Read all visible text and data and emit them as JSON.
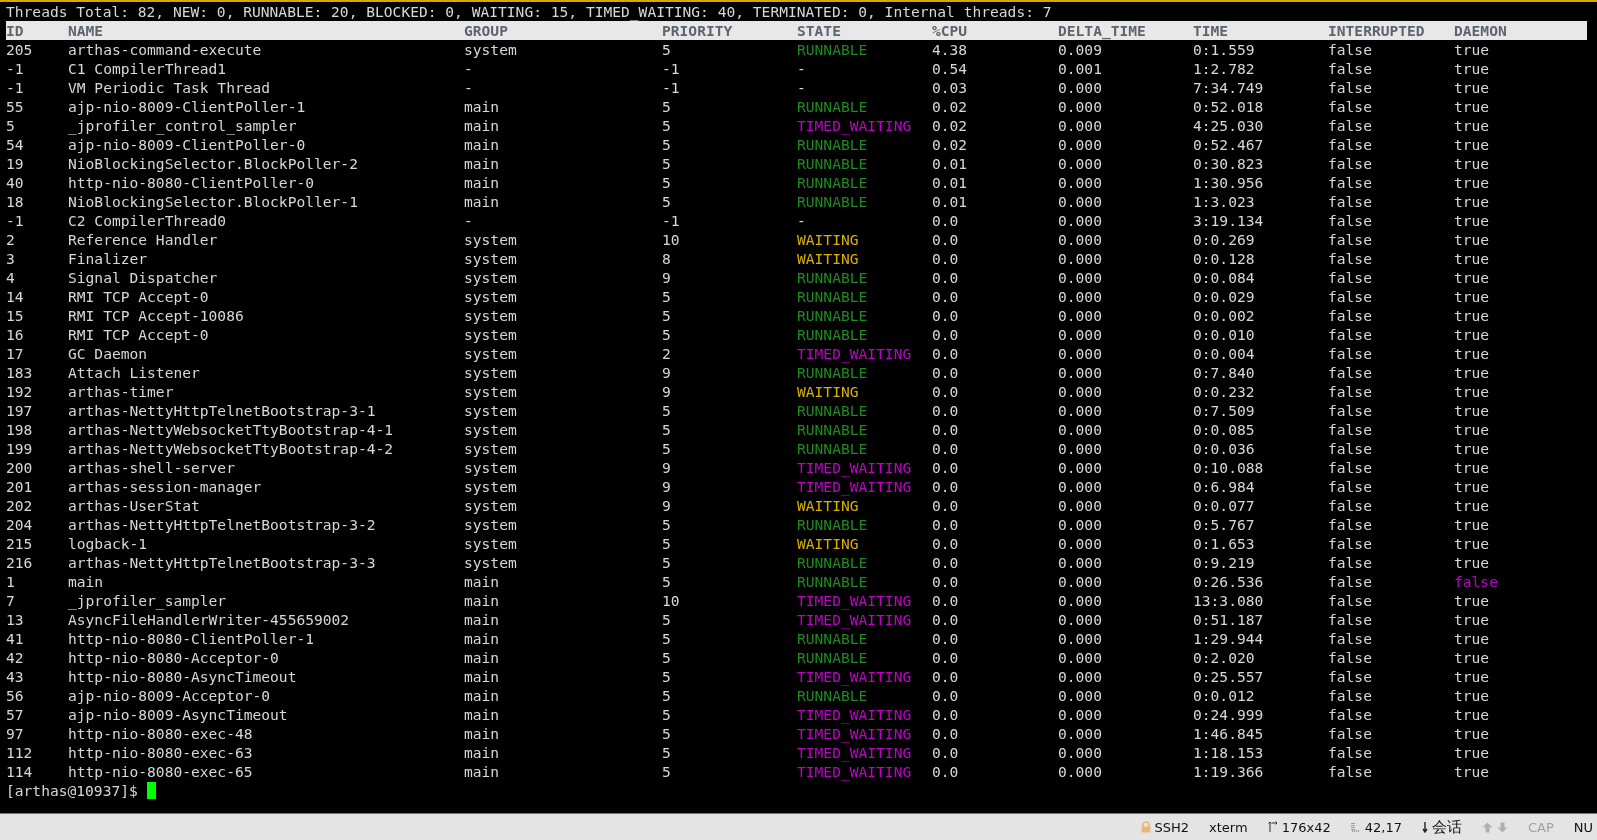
{
  "summary": "Threads Total: 82, NEW: 0, RUNNABLE: 20, BLOCKED: 0, WAITING: 15, TIMED_WAITING: 40, TERMINATED: 0, Internal threads: 7",
  "columns": [
    "ID",
    "NAME",
    "GROUP",
    "PRIORITY",
    "STATE",
    "%CPU",
    "DELTA_TIME",
    "TIME",
    "INTERRUPTED",
    "DAEMON"
  ],
  "rows": [
    {
      "cells": [
        "205",
        "arthas-command-execute",
        "system",
        "5",
        "RUNNABLE",
        "4.38",
        "0.009",
        "0:1.559",
        "false",
        "true"
      ],
      "color": "#1f8a1f",
      "daemon_highlighted": false
    },
    {
      "cells": [
        "-1",
        "C1 CompilerThread1",
        "-",
        "-1",
        "-",
        "0.54",
        "0.001",
        "1:2.782",
        "false",
        "true"
      ],
      "color": "#d8d8d8",
      "daemon_highlighted": false
    },
    {
      "cells": [
        "-1",
        "VM Periodic Task Thread",
        "-",
        "-1",
        "-",
        "0.03",
        "0.000",
        "7:34.749",
        "false",
        "true"
      ],
      "color": "#d8d8d8",
      "daemon_highlighted": false
    },
    {
      "cells": [
        "55",
        "ajp-nio-8009-ClientPoller-1",
        "main",
        "5",
        "RUNNABLE",
        "0.02",
        "0.000",
        "0:52.018",
        "false",
        "true"
      ],
      "color": "#1f8a1f",
      "daemon_highlighted": false
    },
    {
      "cells": [
        "5",
        "_jprofiler_control_sampler",
        "main",
        "5",
        "TIMED_WAITING",
        "0.02",
        "0.000",
        "4:25.030",
        "false",
        "true"
      ],
      "color": "#c000c8",
      "daemon_highlighted": false
    },
    {
      "cells": [
        "54",
        "ajp-nio-8009-ClientPoller-0",
        "main",
        "5",
        "RUNNABLE",
        "0.02",
        "0.000",
        "0:52.467",
        "false",
        "true"
      ],
      "color": "#1f8a1f",
      "daemon_highlighted": false
    },
    {
      "cells": [
        "19",
        "NioBlockingSelector.BlockPoller-2",
        "main",
        "5",
        "RUNNABLE",
        "0.01",
        "0.000",
        "0:30.823",
        "false",
        "true"
      ],
      "color": "#1f8a1f",
      "daemon_highlighted": false
    },
    {
      "cells": [
        "40",
        "http-nio-8080-ClientPoller-0",
        "main",
        "5",
        "RUNNABLE",
        "0.01",
        "0.000",
        "1:30.956",
        "false",
        "true"
      ],
      "color": "#1f8a1f",
      "daemon_highlighted": false
    },
    {
      "cells": [
        "18",
        "NioBlockingSelector.BlockPoller-1",
        "main",
        "5",
        "RUNNABLE",
        "0.01",
        "0.000",
        "1:3.023",
        "false",
        "true"
      ],
      "color": "#1f8a1f",
      "daemon_highlighted": false
    },
    {
      "cells": [
        "-1",
        "C2 CompilerThread0",
        "-",
        "-1",
        "-",
        "0.0",
        "0.000",
        "3:19.134",
        "false",
        "true"
      ],
      "color": "#d8d8d8",
      "daemon_highlighted": false
    },
    {
      "cells": [
        "2",
        "Reference Handler",
        "system",
        "10",
        "WAITING",
        "0.0",
        "0.000",
        "0:0.269",
        "false",
        "true"
      ],
      "color": "#d8b000",
      "daemon_highlighted": false
    },
    {
      "cells": [
        "3",
        "Finalizer",
        "system",
        "8",
        "WAITING",
        "0.0",
        "0.000",
        "0:0.128",
        "false",
        "true"
      ],
      "color": "#d8b000",
      "daemon_highlighted": false
    },
    {
      "cells": [
        "4",
        "Signal Dispatcher",
        "system",
        "9",
        "RUNNABLE",
        "0.0",
        "0.000",
        "0:0.084",
        "false",
        "true"
      ],
      "color": "#1f8a1f",
      "daemon_highlighted": false
    },
    {
      "cells": [
        "14",
        "RMI TCP Accept-0",
        "system",
        "5",
        "RUNNABLE",
        "0.0",
        "0.000",
        "0:0.029",
        "false",
        "true"
      ],
      "color": "#1f8a1f",
      "daemon_highlighted": false
    },
    {
      "cells": [
        "15",
        "RMI TCP Accept-10086",
        "system",
        "5",
        "RUNNABLE",
        "0.0",
        "0.000",
        "0:0.002",
        "false",
        "true"
      ],
      "color": "#1f8a1f",
      "daemon_highlighted": false
    },
    {
      "cells": [
        "16",
        "RMI TCP Accept-0",
        "system",
        "5",
        "RUNNABLE",
        "0.0",
        "0.000",
        "0:0.010",
        "false",
        "true"
      ],
      "color": "#1f8a1f",
      "daemon_highlighted": false
    },
    {
      "cells": [
        "17",
        "GC Daemon",
        "system",
        "2",
        "TIMED_WAITING",
        "0.0",
        "0.000",
        "0:0.004",
        "false",
        "true"
      ],
      "color": "#c000c8",
      "daemon_highlighted": false
    },
    {
      "cells": [
        "183",
        "Attach Listener",
        "system",
        "9",
        "RUNNABLE",
        "0.0",
        "0.000",
        "0:7.840",
        "false",
        "true"
      ],
      "color": "#1f8a1f",
      "daemon_highlighted": false
    },
    {
      "cells": [
        "192",
        "arthas-timer",
        "system",
        "9",
        "WAITING",
        "0.0",
        "0.000",
        "0:0.232",
        "false",
        "true"
      ],
      "color": "#d8b000",
      "daemon_highlighted": false
    },
    {
      "cells": [
        "197",
        "arthas-NettyHttpTelnetBootstrap-3-1",
        "system",
        "5",
        "RUNNABLE",
        "0.0",
        "0.000",
        "0:7.509",
        "false",
        "true"
      ],
      "color": "#1f8a1f",
      "daemon_highlighted": false
    },
    {
      "cells": [
        "198",
        "arthas-NettyWebsocketTtyBootstrap-4-1",
        "system",
        "5",
        "RUNNABLE",
        "0.0",
        "0.000",
        "0:0.085",
        "false",
        "true"
      ],
      "color": "#1f8a1f",
      "daemon_highlighted": false
    },
    {
      "cells": [
        "199",
        "arthas-NettyWebsocketTtyBootstrap-4-2",
        "system",
        "5",
        "RUNNABLE",
        "0.0",
        "0.000",
        "0:0.036",
        "false",
        "true"
      ],
      "color": "#1f8a1f",
      "daemon_highlighted": false
    },
    {
      "cells": [
        "200",
        "arthas-shell-server",
        "system",
        "9",
        "TIMED_WAITING",
        "0.0",
        "0.000",
        "0:10.088",
        "false",
        "true"
      ],
      "color": "#c000c8",
      "daemon_highlighted": false
    },
    {
      "cells": [
        "201",
        "arthas-session-manager",
        "system",
        "9",
        "TIMED_WAITING",
        "0.0",
        "0.000",
        "0:6.984",
        "false",
        "true"
      ],
      "color": "#c000c8",
      "daemon_highlighted": false
    },
    {
      "cells": [
        "202",
        "arthas-UserStat",
        "system",
        "9",
        "WAITING",
        "0.0",
        "0.000",
        "0:0.077",
        "false",
        "true"
      ],
      "color": "#d8b000",
      "daemon_highlighted": false
    },
    {
      "cells": [
        "204",
        "arthas-NettyHttpTelnetBootstrap-3-2",
        "system",
        "5",
        "RUNNABLE",
        "0.0",
        "0.000",
        "0:5.767",
        "false",
        "true"
      ],
      "color": "#1f8a1f",
      "daemon_highlighted": false
    },
    {
      "cells": [
        "215",
        "logback-1",
        "system",
        "5",
        "WAITING",
        "0.0",
        "0.000",
        "0:1.653",
        "false",
        "true"
      ],
      "color": "#d8b000",
      "daemon_highlighted": false
    },
    {
      "cells": [
        "216",
        "arthas-NettyHttpTelnetBootstrap-3-3",
        "system",
        "5",
        "RUNNABLE",
        "0.0",
        "0.000",
        "0:9.219",
        "false",
        "true"
      ],
      "color": "#1f8a1f",
      "daemon_highlighted": false
    },
    {
      "cells": [
        "1",
        "main",
        "main",
        "5",
        "RUNNABLE",
        "0.0",
        "0.000",
        "0:26.536",
        "false",
        "false"
      ],
      "color": "#1f8a1f",
      "daemon_highlighted": true
    },
    {
      "cells": [
        "7",
        "_jprofiler_sampler",
        "main",
        "10",
        "TIMED_WAITING",
        "0.0",
        "0.000",
        "13:3.080",
        "false",
        "true"
      ],
      "color": "#c000c8",
      "daemon_highlighted": false
    },
    {
      "cells": [
        "13",
        "AsyncFileHandlerWriter-455659002",
        "main",
        "5",
        "TIMED_WAITING",
        "0.0",
        "0.000",
        "0:51.187",
        "false",
        "true"
      ],
      "color": "#c000c8",
      "daemon_highlighted": false
    },
    {
      "cells": [
        "41",
        "http-nio-8080-ClientPoller-1",
        "main",
        "5",
        "RUNNABLE",
        "0.0",
        "0.000",
        "1:29.944",
        "false",
        "true"
      ],
      "color": "#1f8a1f",
      "daemon_highlighted": false
    },
    {
      "cells": [
        "42",
        "http-nio-8080-Acceptor-0",
        "main",
        "5",
        "RUNNABLE",
        "0.0",
        "0.000",
        "0:2.020",
        "false",
        "true"
      ],
      "color": "#1f8a1f",
      "daemon_highlighted": false
    },
    {
      "cells": [
        "43",
        "http-nio-8080-AsyncTimeout",
        "main",
        "5",
        "TIMED_WAITING",
        "0.0",
        "0.000",
        "0:25.557",
        "false",
        "true"
      ],
      "color": "#c000c8",
      "daemon_highlighted": false
    },
    {
      "cells": [
        "56",
        "ajp-nio-8009-Acceptor-0",
        "main",
        "5",
        "RUNNABLE",
        "0.0",
        "0.000",
        "0:0.012",
        "false",
        "true"
      ],
      "color": "#1f8a1f",
      "daemon_highlighted": false
    },
    {
      "cells": [
        "57",
        "ajp-nio-8009-AsyncTimeout",
        "main",
        "5",
        "TIMED_WAITING",
        "0.0",
        "0.000",
        "0:24.999",
        "false",
        "true"
      ],
      "color": "#c000c8",
      "daemon_highlighted": false
    },
    {
      "cells": [
        "97",
        "http-nio-8080-exec-48",
        "main",
        "5",
        "TIMED_WAITING",
        "0.0",
        "0.000",
        "1:46.845",
        "false",
        "true"
      ],
      "color": "#c000c8",
      "daemon_highlighted": false
    },
    {
      "cells": [
        "112",
        "http-nio-8080-exec-63",
        "main",
        "5",
        "TIMED_WAITING",
        "0.0",
        "0.000",
        "1:18.153",
        "false",
        "true"
      ],
      "color": "#c000c8",
      "daemon_highlighted": false
    },
    {
      "cells": [
        "114",
        "http-nio-8080-exec-65",
        "main",
        "5",
        "TIMED_WAITING",
        "0.0",
        "0.000",
        "1:19.366",
        "false",
        "true"
      ],
      "color": "#c000c8",
      "daemon_highlighted": false
    }
  ],
  "prompt": "[arthas@10937]$",
  "status_bar": [
    {
      "kind": "lock",
      "text": "SSH2"
    },
    {
      "kind": "plain",
      "text": "xterm"
    },
    {
      "kind": "size",
      "text": "176x42"
    },
    {
      "kind": "cursor",
      "text": "42,17"
    },
    {
      "kind": "session",
      "text": "会话"
    },
    {
      "kind": "arrows"
    },
    {
      "kind": "disabled",
      "text": "CAP"
    },
    {
      "kind": "plain",
      "text": "NU"
    }
  ]
}
